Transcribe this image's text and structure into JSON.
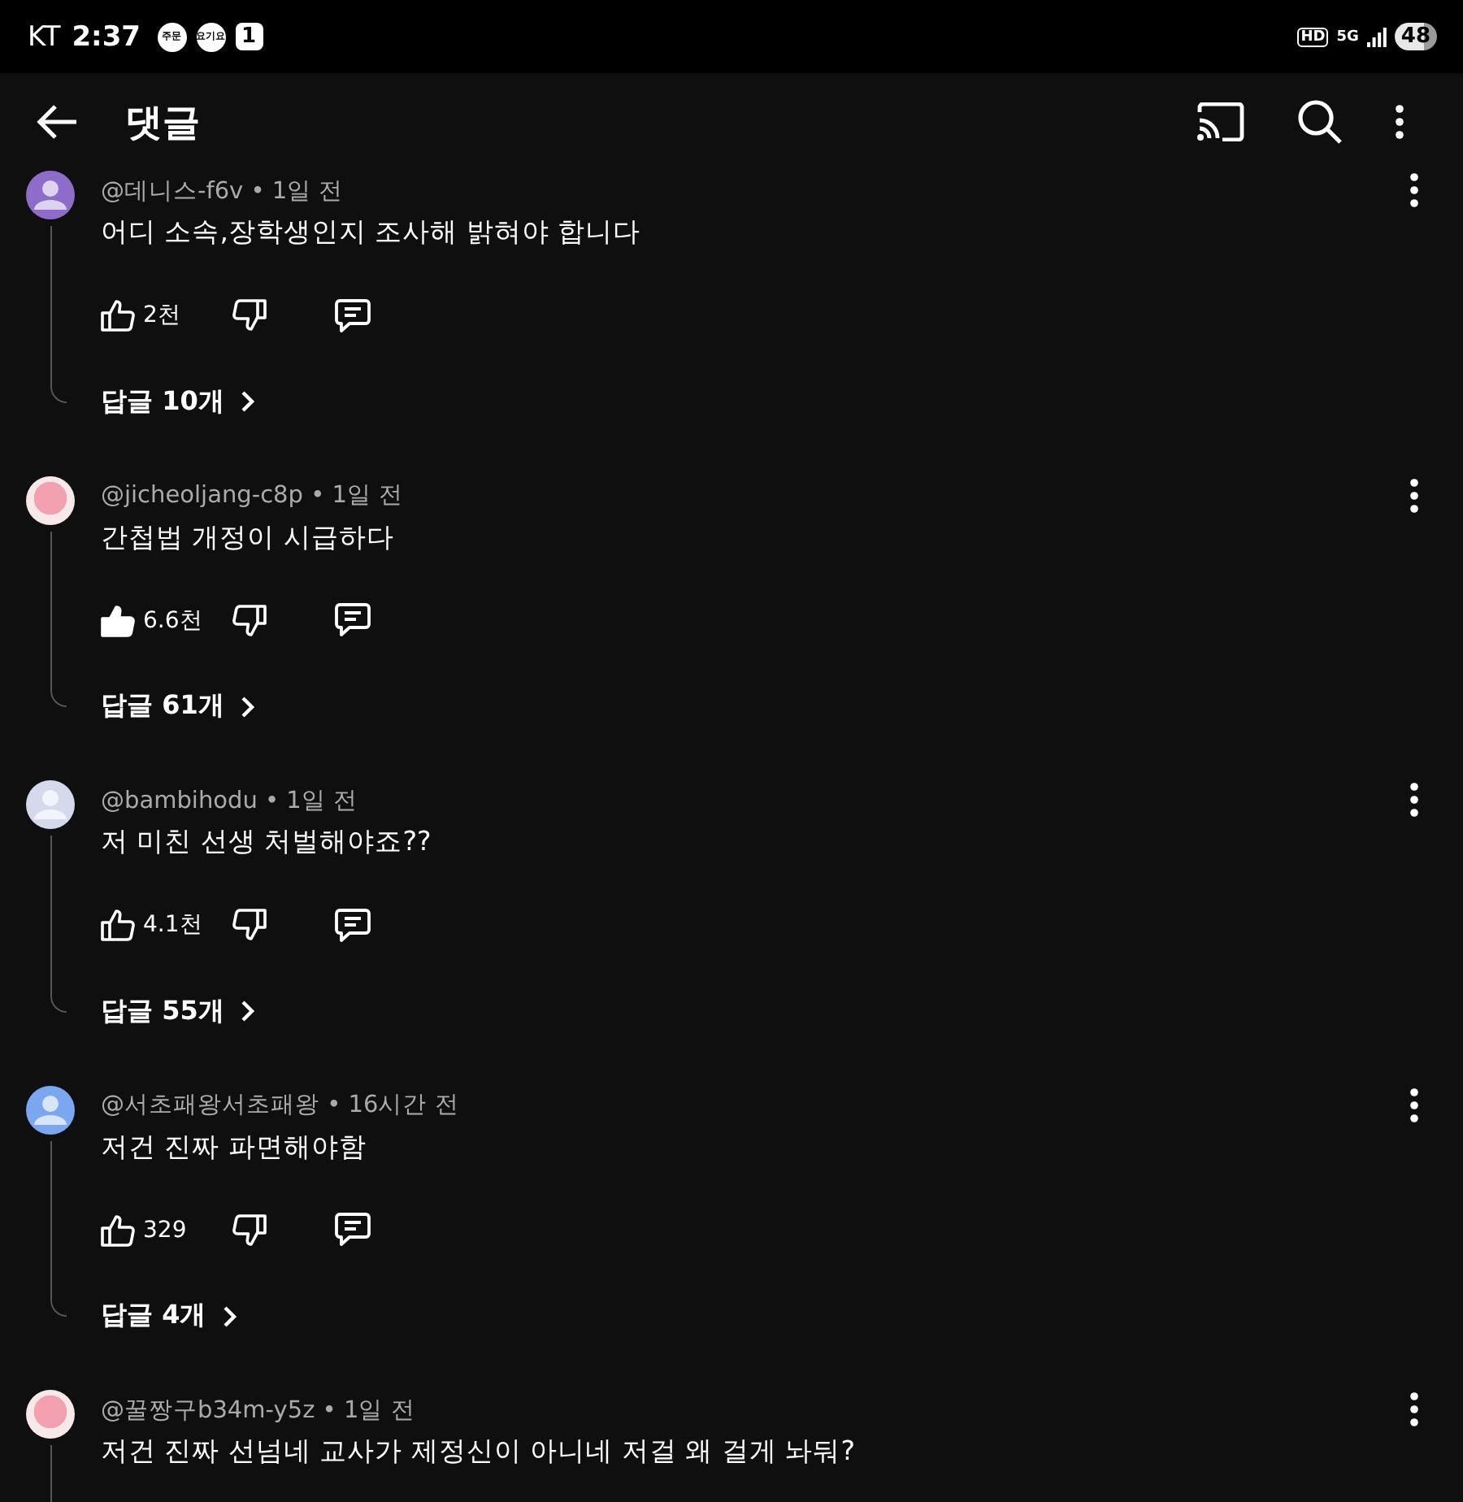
{
  "status_bar": {
    "carrier": "KT",
    "time": "2:37",
    "notification_badges": [
      "주문",
      "요기요"
    ],
    "app_badge": "1",
    "hd": "HD",
    "network": "5G",
    "battery": "48"
  },
  "app_bar": {
    "title": "댓글"
  },
  "comments": [
    {
      "meta": "@데니스-f6v • 1일 전",
      "text": "어디 소속,장학생인지 조사해 밝혀야 합니다",
      "avatar": {
        "kind": "default",
        "color": "#8e6cc9"
      },
      "likes": "2천",
      "liked": false,
      "replies": "답글 10개"
    },
    {
      "meta": "@jicheoljang-c8p • 1일 전",
      "text": "간첩법 개정이 시급하다",
      "avatar": {
        "kind": "picture"
      },
      "likes": "6.6천",
      "liked": true,
      "replies": "답글 61개"
    },
    {
      "meta": "@bambihodu • 1일 전",
      "text": "저 미친 선생 처벌해야죠??",
      "avatar": {
        "kind": "default",
        "color": "#d6d9ec"
      },
      "likes": "4.1천",
      "liked": false,
      "replies": "답글 55개"
    },
    {
      "meta": "@서초패왕서초패왕 • 16시간 전",
      "text": "저건 진짜 파면해야함",
      "avatar": {
        "kind": "default",
        "color": "#7ba7f0"
      },
      "likes": "329",
      "liked": false,
      "replies": "답글 4개"
    },
    {
      "meta": "@꿀짱구b34m-y5z • 1일 전",
      "text": "저건 진짜 선넘네 교사가 제정신이 아니네 저걸 왜 걸게 놔둬?",
      "avatar": {
        "kind": "picture"
      }
    }
  ]
}
